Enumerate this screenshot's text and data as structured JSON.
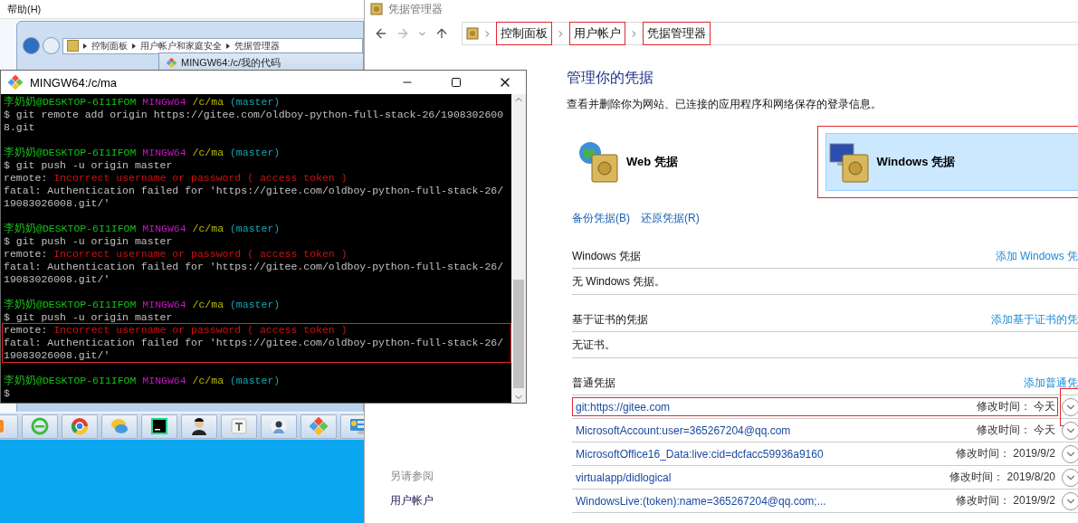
{
  "back_window": {
    "menu": [
      "帮助(H)"
    ],
    "breadcrumbs": [
      "控制面板",
      "用户帐户和家庭安全",
      "凭据管理器"
    ],
    "inner_window_title": "MINGW64:/c/我的代码"
  },
  "credential_manager": {
    "title": "凭据管理器",
    "breadcrumbs": [
      {
        "label": "控制面板",
        "highlighted": true
      },
      {
        "label": "用户帐户",
        "highlighted": true
      },
      {
        "label": "凭据管理器",
        "highlighted": true
      }
    ],
    "heading": "管理你的凭据",
    "description": "查看并删除你为网站、已连接的应用程序和网络保存的登录信息。",
    "vaults": [
      {
        "label": "Web 凭据",
        "kind": "web",
        "selected": false,
        "highlighted": false
      },
      {
        "label": "Windows 凭据",
        "kind": "windows",
        "selected": true,
        "highlighted": true
      }
    ],
    "actions": [
      "备份凭据(B)",
      "还原凭据(R)"
    ],
    "sections": [
      {
        "title": "Windows 凭据",
        "add_link": "添加 Windows 凭",
        "empty_text": "无 Windows 凭据。"
      },
      {
        "title": "基于证书的凭据",
        "add_link": "添加基于证书的凭",
        "empty_text": "无证书。"
      },
      {
        "title": "普通凭据",
        "add_link": "添加普通凭",
        "items": [
          {
            "name": "git:https://gitee.com",
            "modified_label": "修改时间：",
            "modified": "今天",
            "highlighted": true,
            "expanded": false
          },
          {
            "name": "MicrosoftAccount:user=365267204@qq.com",
            "modified_label": "修改时间：",
            "modified": "今天",
            "highlighted": false,
            "expanded": false
          },
          {
            "name": "MicrosoftOffice16_Data:live:cid=dcfacc59936a9160",
            "modified_label": "修改时间：",
            "modified": "2019/9/2",
            "highlighted": false,
            "expanded": false
          },
          {
            "name": "virtualapp/didlogical",
            "modified_label": "修改时间：",
            "modified": "2019/8/20",
            "highlighted": false,
            "expanded": false
          },
          {
            "name": "WindowsLive:(token):name=365267204@qq.com;...",
            "modified_label": "修改时间：",
            "modified": "2019/9/2",
            "highlighted": false,
            "expanded": false
          }
        ]
      }
    ],
    "see_also": {
      "title": "另请参阅",
      "links": [
        "用户帐户"
      ]
    }
  },
  "terminal": {
    "title": "MINGW64:/c/ma",
    "lines": [
      {
        "kind": "prompt",
        "user": "李奶奶@DESKTOP-6I1IFOM",
        "env": "MINGW64",
        "path": "/c/ma",
        "branch": "(master)"
      },
      {
        "kind": "text",
        "text": "$ git remote add origin https://gitee.com/oldboy-python-full-stack-26/1908302600"
      },
      {
        "kind": "text",
        "text": "8.git"
      },
      {
        "kind": "blank"
      },
      {
        "kind": "prompt",
        "user": "李奶奶@DESKTOP-6I1IFOM",
        "env": "MINGW64",
        "path": "/c/ma",
        "branch": "(master)"
      },
      {
        "kind": "text",
        "text": "$ git push -u origin master"
      },
      {
        "kind": "error",
        "prefix": "remote:",
        "text": "Incorrect username or password ( access token )"
      },
      {
        "kind": "text",
        "text": "fatal: Authentication failed for 'https://gitee.com/oldboy-python-full-stack-26/"
      },
      {
        "kind": "text",
        "text": "19083026008.git/'"
      },
      {
        "kind": "blank"
      },
      {
        "kind": "prompt",
        "user": "李奶奶@DESKTOP-6I1IFOM",
        "env": "MINGW64",
        "path": "/c/ma",
        "branch": "(master)"
      },
      {
        "kind": "text",
        "text": "$ git push -u origin master"
      },
      {
        "kind": "error",
        "prefix": "remote:",
        "text": "Incorrect username or password ( access token )"
      },
      {
        "kind": "text",
        "text": "fatal: Authentication failed for 'https://gitee.com/oldboy-python-full-stack-26/"
      },
      {
        "kind": "text",
        "text": "19083026008.git/'"
      },
      {
        "kind": "blank"
      },
      {
        "kind": "prompt",
        "user": "李奶奶@DESKTOP-6I1IFOM",
        "env": "MINGW64",
        "path": "/c/ma",
        "branch": "(master)"
      },
      {
        "kind": "text",
        "text": "$ git push -u origin master"
      },
      {
        "kind": "error",
        "prefix": "remote:",
        "text": "Incorrect username or password ( access token )",
        "boxed": true
      },
      {
        "kind": "text",
        "text": "fatal: Authentication failed for 'https://gitee.com/oldboy-python-full-stack-26/",
        "boxed": true
      },
      {
        "kind": "text",
        "text": "19083026008.git/'",
        "boxed": true
      },
      {
        "kind": "blank"
      },
      {
        "kind": "prompt",
        "user": "李奶奶@DESKTOP-6I1IFOM",
        "env": "MINGW64",
        "path": "/c/ma",
        "branch": "(master)"
      },
      {
        "kind": "text",
        "text": "$"
      }
    ]
  }
}
